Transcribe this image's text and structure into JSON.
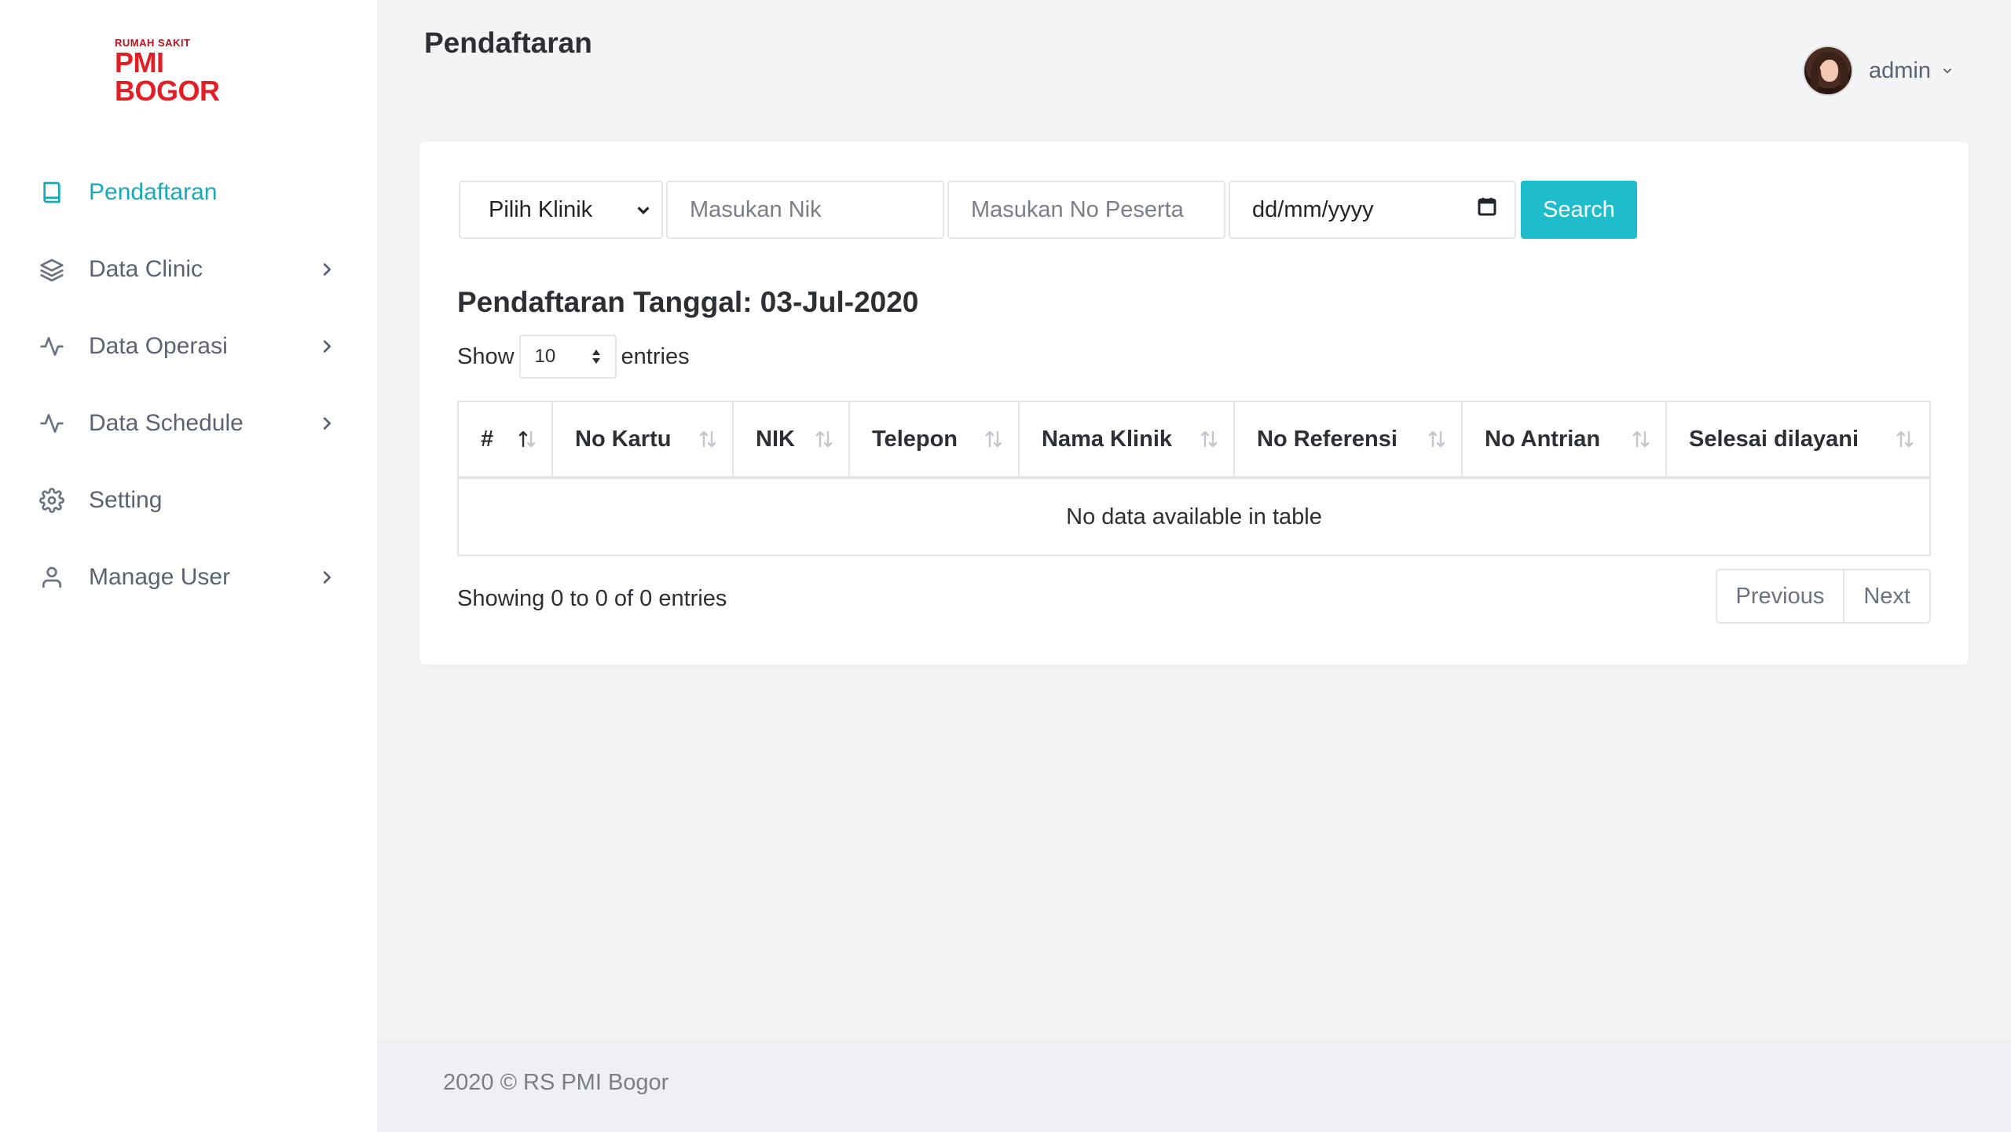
{
  "logo": {
    "small": "RUMAH SAKIT",
    "big": "PMI BOGOR"
  },
  "sidebar": {
    "items": [
      {
        "label": "Pendaftaran",
        "icon": "book-icon",
        "active": true,
        "has_children": false
      },
      {
        "label": "Data Clinic",
        "icon": "layers-icon",
        "active": false,
        "has_children": true
      },
      {
        "label": "Data Operasi",
        "icon": "activity-icon",
        "active": false,
        "has_children": true
      },
      {
        "label": "Data Schedule",
        "icon": "activity-icon",
        "active": false,
        "has_children": true
      },
      {
        "label": "Setting",
        "icon": "gear-icon",
        "active": false,
        "has_children": false
      },
      {
        "label": "Manage User",
        "icon": "user-icon",
        "active": false,
        "has_children": true
      }
    ]
  },
  "header": {
    "title": "Pendaftaran",
    "user": "admin"
  },
  "filters": {
    "klinik_selected": "Pilih Klinik",
    "nik_placeholder": "Masukan Nik",
    "peserta_placeholder": "Masukan No Peserta",
    "date_placeholder": "dd/mm/yyyy",
    "search_label": "Search"
  },
  "section_title": "Pendaftaran Tanggal: 03-Jul-2020",
  "length": {
    "show": "Show",
    "value": "10",
    "entries": "entries"
  },
  "table": {
    "columns": [
      "#",
      "No Kartu",
      "NIK",
      "Telepon",
      "Nama Klinik",
      "No Referensi",
      "No Antrian",
      "Selesai dilayani"
    ],
    "empty": "No data available in table",
    "info": "Showing 0 to 0 of 0 entries"
  },
  "pager": {
    "previous": "Previous",
    "next": "Next"
  },
  "footer": "2020 © RS PMI Bogor",
  "colors": {
    "accent": "#1fbccc",
    "active_nav": "#17a9b8",
    "logo_red": "#e31e24"
  }
}
